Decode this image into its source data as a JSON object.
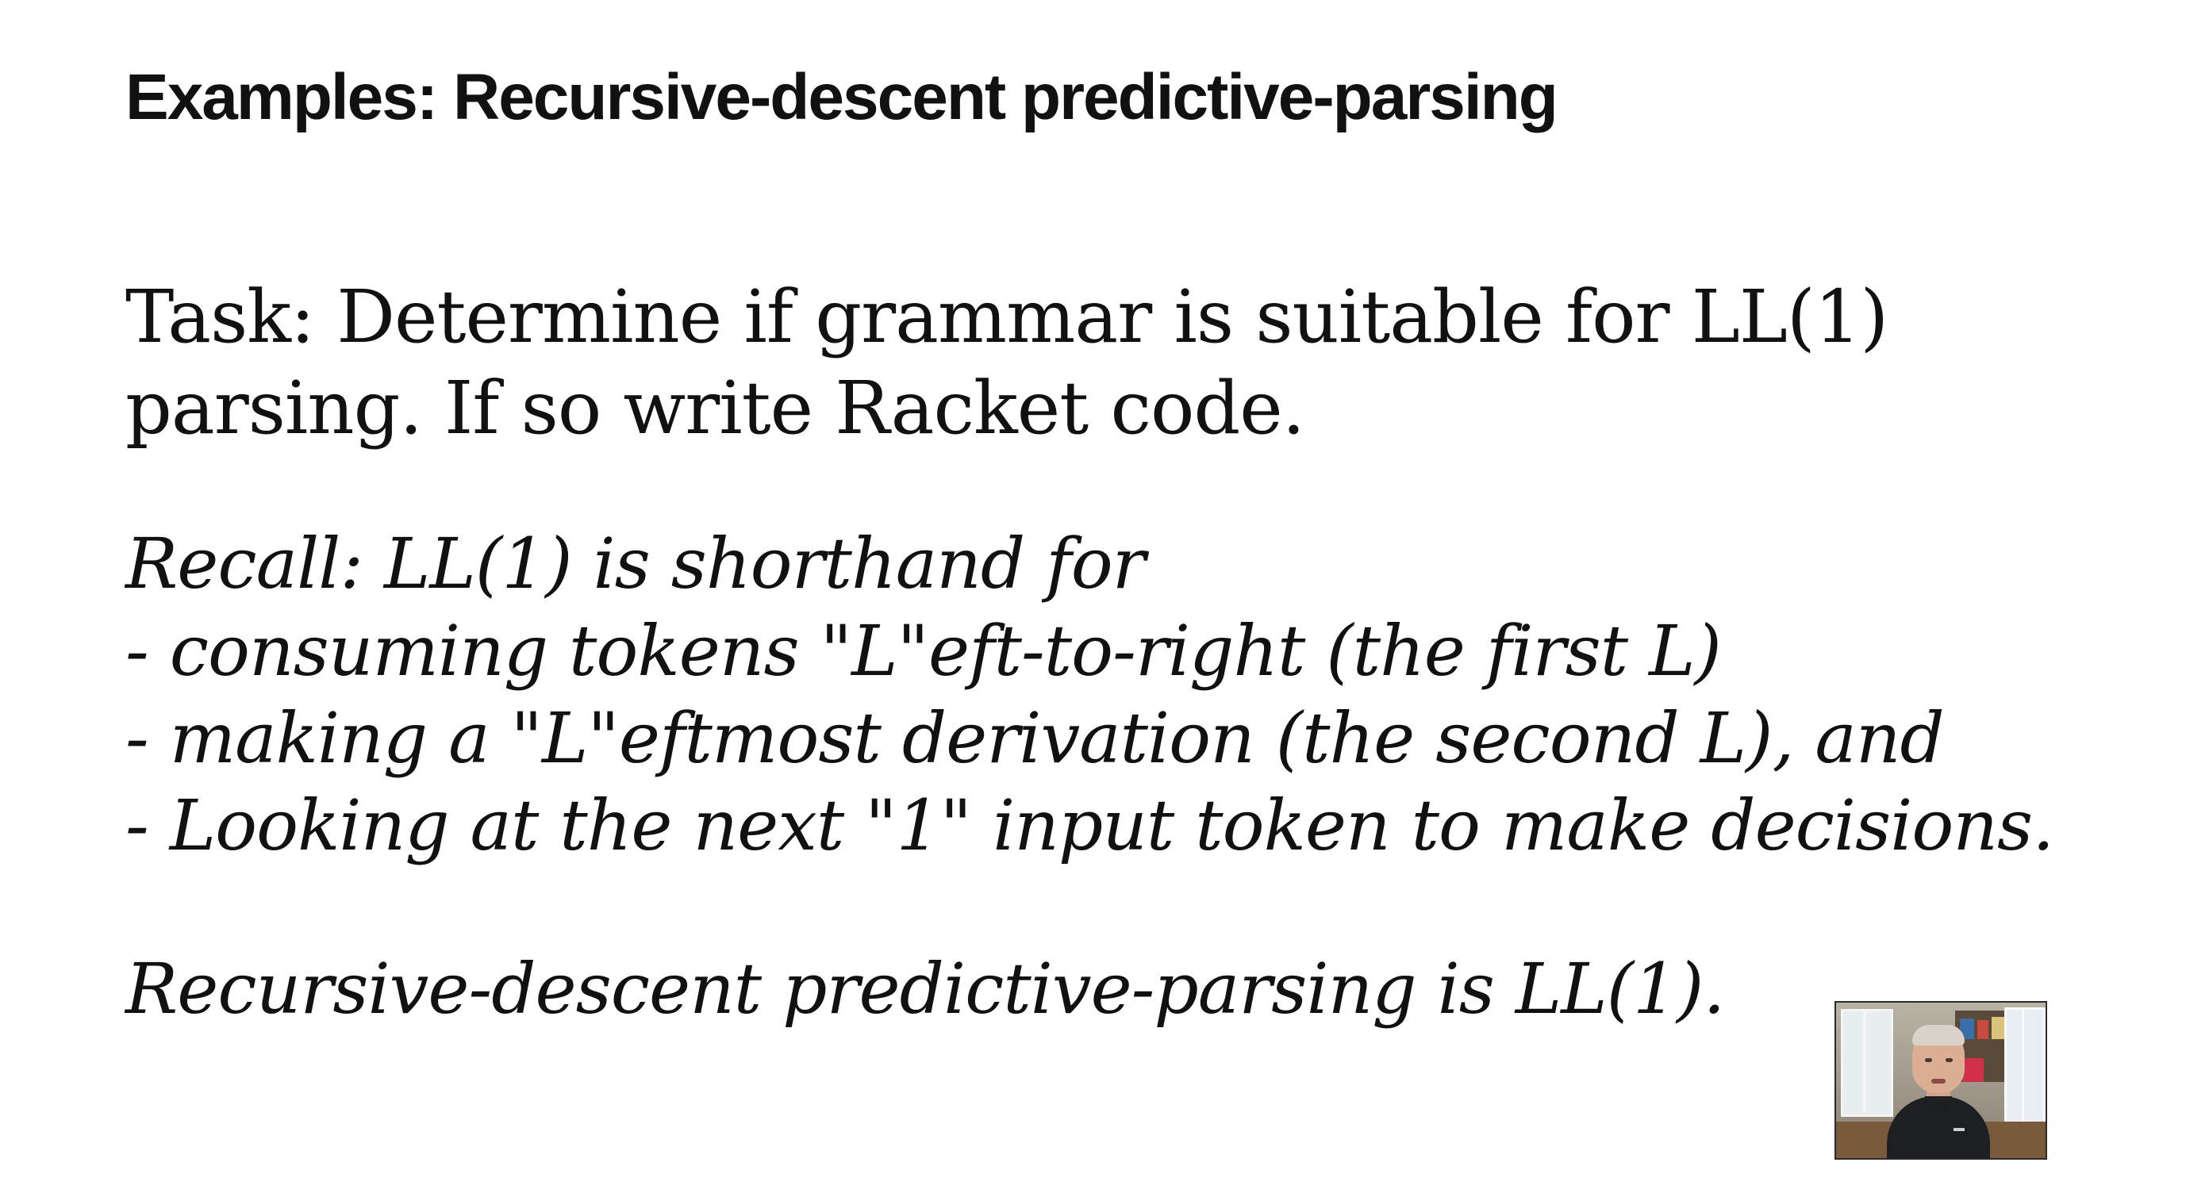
{
  "slide": {
    "title": "Examples: Recursive-descent predictive-parsing",
    "task_lines": [
      "Task: Determine if grammar is suitable for LL(1)",
      "parsing. If so write Racket code."
    ],
    "recall_lines": [
      "Recall: LL(1) is shorthand for",
      "- consuming tokens \"L\"eft-to-right (the first L)",
      "- making a \"L\"eftmost derivation (the second L), and",
      "- Looking at the next \"1\" input token to make decisions."
    ],
    "conclusion": "Recursive-descent predictive-parsing is LL(1)."
  },
  "webcam": {
    "icon": "presenter-video-thumbnail"
  }
}
